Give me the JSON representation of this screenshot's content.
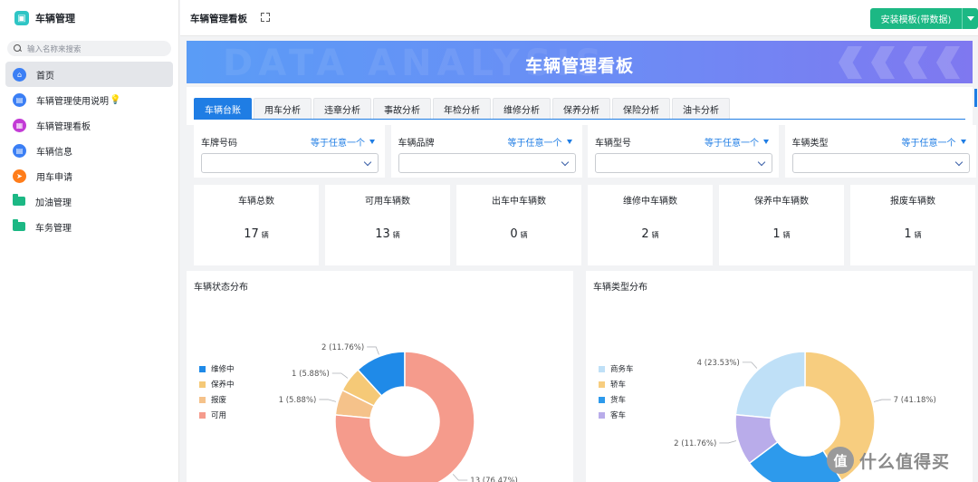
{
  "app": {
    "title": "车辆管理"
  },
  "search": {
    "placeholder": "输入名称来搜索"
  },
  "nav": [
    {
      "label": "首页",
      "icon": "home-icon",
      "color": "#3b7ff5",
      "active": true
    },
    {
      "label": "车辆管理使用说明",
      "icon": "doc-icon",
      "color": "#3b7ff5",
      "bulb": "💡"
    },
    {
      "label": "车辆管理看板",
      "icon": "dashboard-icon",
      "color": "#c33bd6"
    },
    {
      "label": "车辆信息",
      "icon": "doc-icon",
      "color": "#3b7ff5"
    },
    {
      "label": "用车申请",
      "icon": "send-icon",
      "color": "#ff7d1a"
    },
    {
      "label": "加油管理",
      "icon": "folder-icon",
      "color": "#1cb884"
    },
    {
      "label": "车务管理",
      "icon": "folder-icon",
      "color": "#1cb884"
    }
  ],
  "topbar": {
    "title": "车辆管理看板",
    "install_label": "安装模板(带数据)"
  },
  "banner": {
    "title": "车辆管理看板",
    "watermark": "DATA ANALYSIS"
  },
  "tabs": [
    "车辆台账",
    "用车分析",
    "违章分析",
    "事故分析",
    "年检分析",
    "维修分析",
    "保养分析",
    "保险分析",
    "油卡分析"
  ],
  "filters": [
    {
      "label": "车牌号码",
      "op": "等于任意一个"
    },
    {
      "label": "车辆品牌",
      "op": "等于任意一个"
    },
    {
      "label": "车辆型号",
      "op": "等于任意一个"
    },
    {
      "label": "车辆类型",
      "op": "等于任意一个"
    }
  ],
  "kpis": [
    {
      "label": "车辆总数",
      "value": "17",
      "unit": "辆"
    },
    {
      "label": "可用车辆数",
      "value": "13",
      "unit": "辆"
    },
    {
      "label": "出车中车辆数",
      "value": "0",
      "unit": "辆"
    },
    {
      "label": "维修中车辆数",
      "value": "2",
      "unit": "辆"
    },
    {
      "label": "保养中车辆数",
      "value": "1",
      "unit": "辆"
    },
    {
      "label": "报废车辆数",
      "value": "1",
      "unit": "辆"
    }
  ],
  "chart_data": [
    {
      "type": "pie",
      "title": "车辆状态分布",
      "categories": [
        "维修中",
        "保养中",
        "报废",
        "可用"
      ],
      "values": [
        2,
        1,
        1,
        13
      ],
      "labels": [
        "2 (11.76%)",
        "1 (5.88%)",
        "1 (5.88%)",
        "13 (76.47%)"
      ],
      "colors": [
        "#1f8ae8",
        "#f5c977",
        "#f5c28a",
        "#f59b8c"
      ],
      "legend": "left"
    },
    {
      "type": "pie",
      "title": "车辆类型分布",
      "categories": [
        "商务车",
        "轿车",
        "货车",
        "客车"
      ],
      "values": [
        4,
        7,
        4,
        2
      ],
      "labels": [
        "4 (23.53%)",
        "7 (41.18%)",
        "4 (23.53%)",
        "2 (11.76%)"
      ],
      "colors": [
        "#bfe0f7",
        "#f7cd7f",
        "#2d9aec",
        "#b9acea"
      ],
      "legend": "left"
    }
  ],
  "watermark": {
    "badge": "值",
    "text": "什么值得买"
  }
}
